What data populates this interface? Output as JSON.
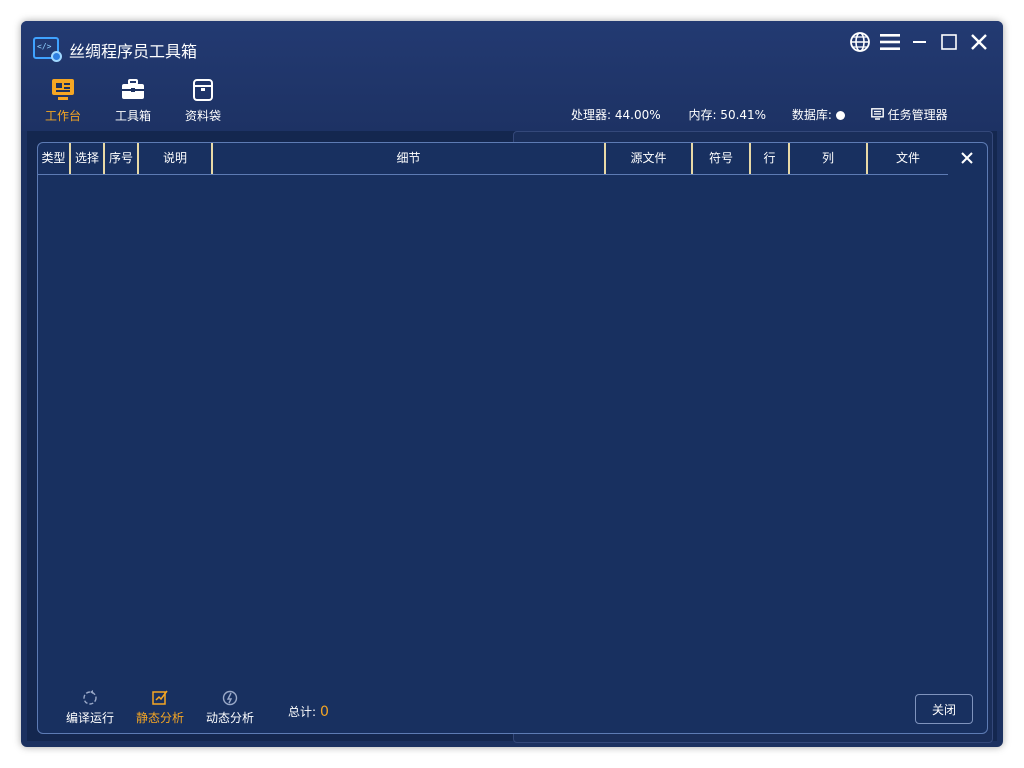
{
  "app": {
    "title": "丝绸程序员工具箱"
  },
  "nav": [
    {
      "label": "工作台",
      "active": true
    },
    {
      "label": "工具箱",
      "active": false
    },
    {
      "label": "资料袋",
      "active": false
    }
  ],
  "stats": {
    "cpu": "处理器: 44.00%",
    "memory": "内存: 50.41%",
    "db": "数据库:",
    "task_manager": "任务管理器"
  },
  "grid": {
    "columns": [
      "类型",
      "选择",
      "序号",
      "说明",
      "细节",
      "源文件",
      "符号",
      "行",
      "列",
      "文件"
    ]
  },
  "footer": {
    "tools": [
      {
        "label": "编译运行",
        "active": false
      },
      {
        "label": "静态分析",
        "active": true
      },
      {
        "label": "动态分析",
        "active": false
      }
    ],
    "total_label": "总计:",
    "total_value": "0",
    "close_label": "关闭"
  },
  "colors": {
    "bg": "#1c3160",
    "accent": "#f5a623",
    "border": "#5d7bb4",
    "header_sep": "#e8d9a6"
  }
}
